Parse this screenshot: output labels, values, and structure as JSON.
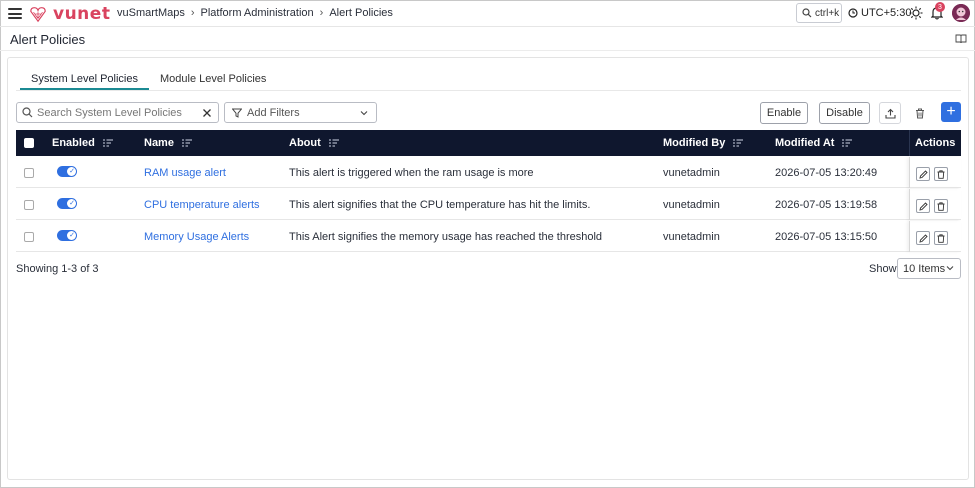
{
  "topbar": {
    "brand": "vunet",
    "breadcrumb": [
      "vuSmartMaps",
      "Platform Administration",
      "Alert Policies"
    ],
    "search_shortcut": "ctrl+k",
    "timezone": "UTC+5:30",
    "notification_count": "3",
    "icons": [
      "menu-icon",
      "search-icon",
      "clock-icon",
      "sun-icon",
      "bell-icon",
      "avatar"
    ]
  },
  "page": {
    "title": "Alert Policies"
  },
  "tabs": [
    {
      "label": "System Level Policies",
      "active": true
    },
    {
      "label": "Module Level Policies",
      "active": false
    }
  ],
  "toolbar": {
    "search_placeholder": "Search System Level Policies",
    "filter_label": "Add Filters",
    "enable_label": "Enable",
    "disable_label": "Disable",
    "add_label": "+"
  },
  "table": {
    "columns": {
      "enabled": "Enabled",
      "name": "Name",
      "about": "About",
      "modified_by": "Modified By",
      "modified_at": "Modified At",
      "actions": "Actions"
    },
    "rows": [
      {
        "enabled": true,
        "name": "RAM usage alert",
        "about": "This alert is triggered when the ram usage is more",
        "modified_by": "vunetadmin",
        "modified_at": "2026-07-05 13:20:49"
      },
      {
        "enabled": true,
        "name": "CPU temperature alerts",
        "about": "This alert signifies that the CPU temperature has hit the limits.",
        "modified_by": "vunetadmin",
        "modified_at": "2026-07-05 13:19:58"
      },
      {
        "enabled": true,
        "name": "Memory Usage Alerts",
        "about": "This Alert signifies the memory usage has reached the threshold",
        "modified_by": "vunetadmin",
        "modified_at": "2026-07-05 13:15:50"
      }
    ]
  },
  "footer": {
    "showing": "Showing 1-3 of 3",
    "show_label": "Show",
    "page_size": "10 Items"
  },
  "colors": {
    "brand": "#d9435f",
    "accent": "#2f6fe0",
    "header_bg": "#0f172e",
    "tab_underline": "#1b8a93"
  }
}
